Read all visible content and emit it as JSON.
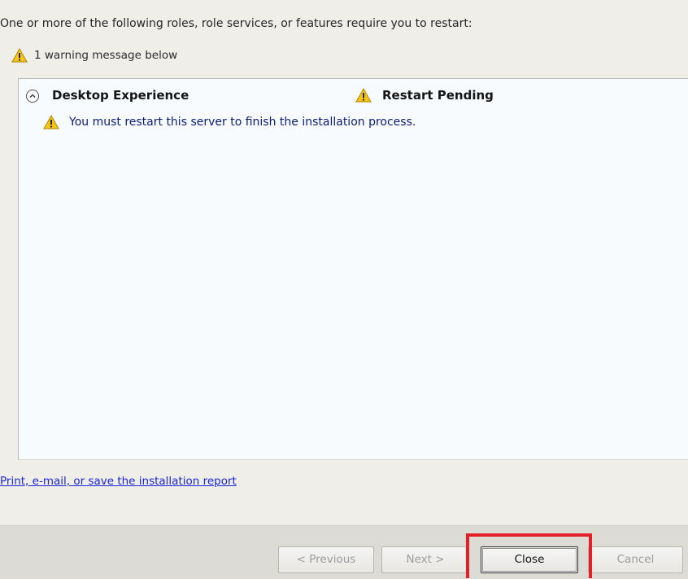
{
  "header": {
    "intro_text": "One or more of the following roles, role services, or features require you to restart:",
    "warning_summary": "1 warning message below"
  },
  "results": {
    "feature_name": "Desktop Experience",
    "status": "Restart Pending",
    "message": "You must restart this server to finish the installation process."
  },
  "report_link": "Print, e-mail, or save the installation report",
  "buttons": {
    "previous": "< Previous",
    "next": "Next >",
    "close": "Close",
    "cancel": "Cancel"
  },
  "icons": {
    "warning": "warning-icon",
    "collapse": "chevron-up-circle-icon"
  },
  "colors": {
    "link": "#1a24d6",
    "message": "#0a1a7a",
    "highlight": "#e41f25",
    "warning_fill": "#f5c518"
  }
}
